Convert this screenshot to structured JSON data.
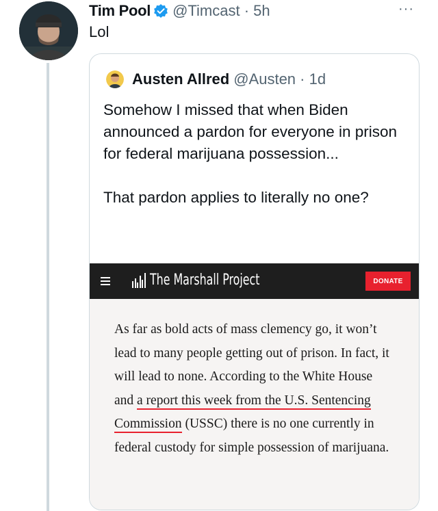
{
  "tweet": {
    "author_name": "Tim Pool",
    "handle_time": "@Timcast · 5h",
    "more": "···",
    "text": "Lol"
  },
  "quote": {
    "author_name": "Austen Allred",
    "handle_time": "@Austen · 1d",
    "paragraphs": [
      "Somehow I missed that when Biden announced a pardon for everyone in prison for federal marijuana possession...",
      "That pardon applies to literally no one?"
    ]
  },
  "embed": {
    "site_title": "The Marshall Project",
    "donate_label": "DONATE",
    "article": {
      "part1": "As far as bold acts of mass clemency go, it won’t lead to many people getting out of prison. In fact, it will lead to none. According to the White House and ",
      "link1": "a report this week from the U.S. Sentencing Commission",
      "part2": " (USSC) there is no one currently in federal custody for simple possession of marijuana."
    }
  },
  "colors": {
    "verified": "#1d9bf0",
    "donate": "#e8212e",
    "site_bar": "#1e1e1e",
    "muted_text": "#536471"
  },
  "icons": [
    "verified-badge-icon",
    "more-options-icon",
    "menu-icon",
    "marshall-project-logo-icon"
  ]
}
